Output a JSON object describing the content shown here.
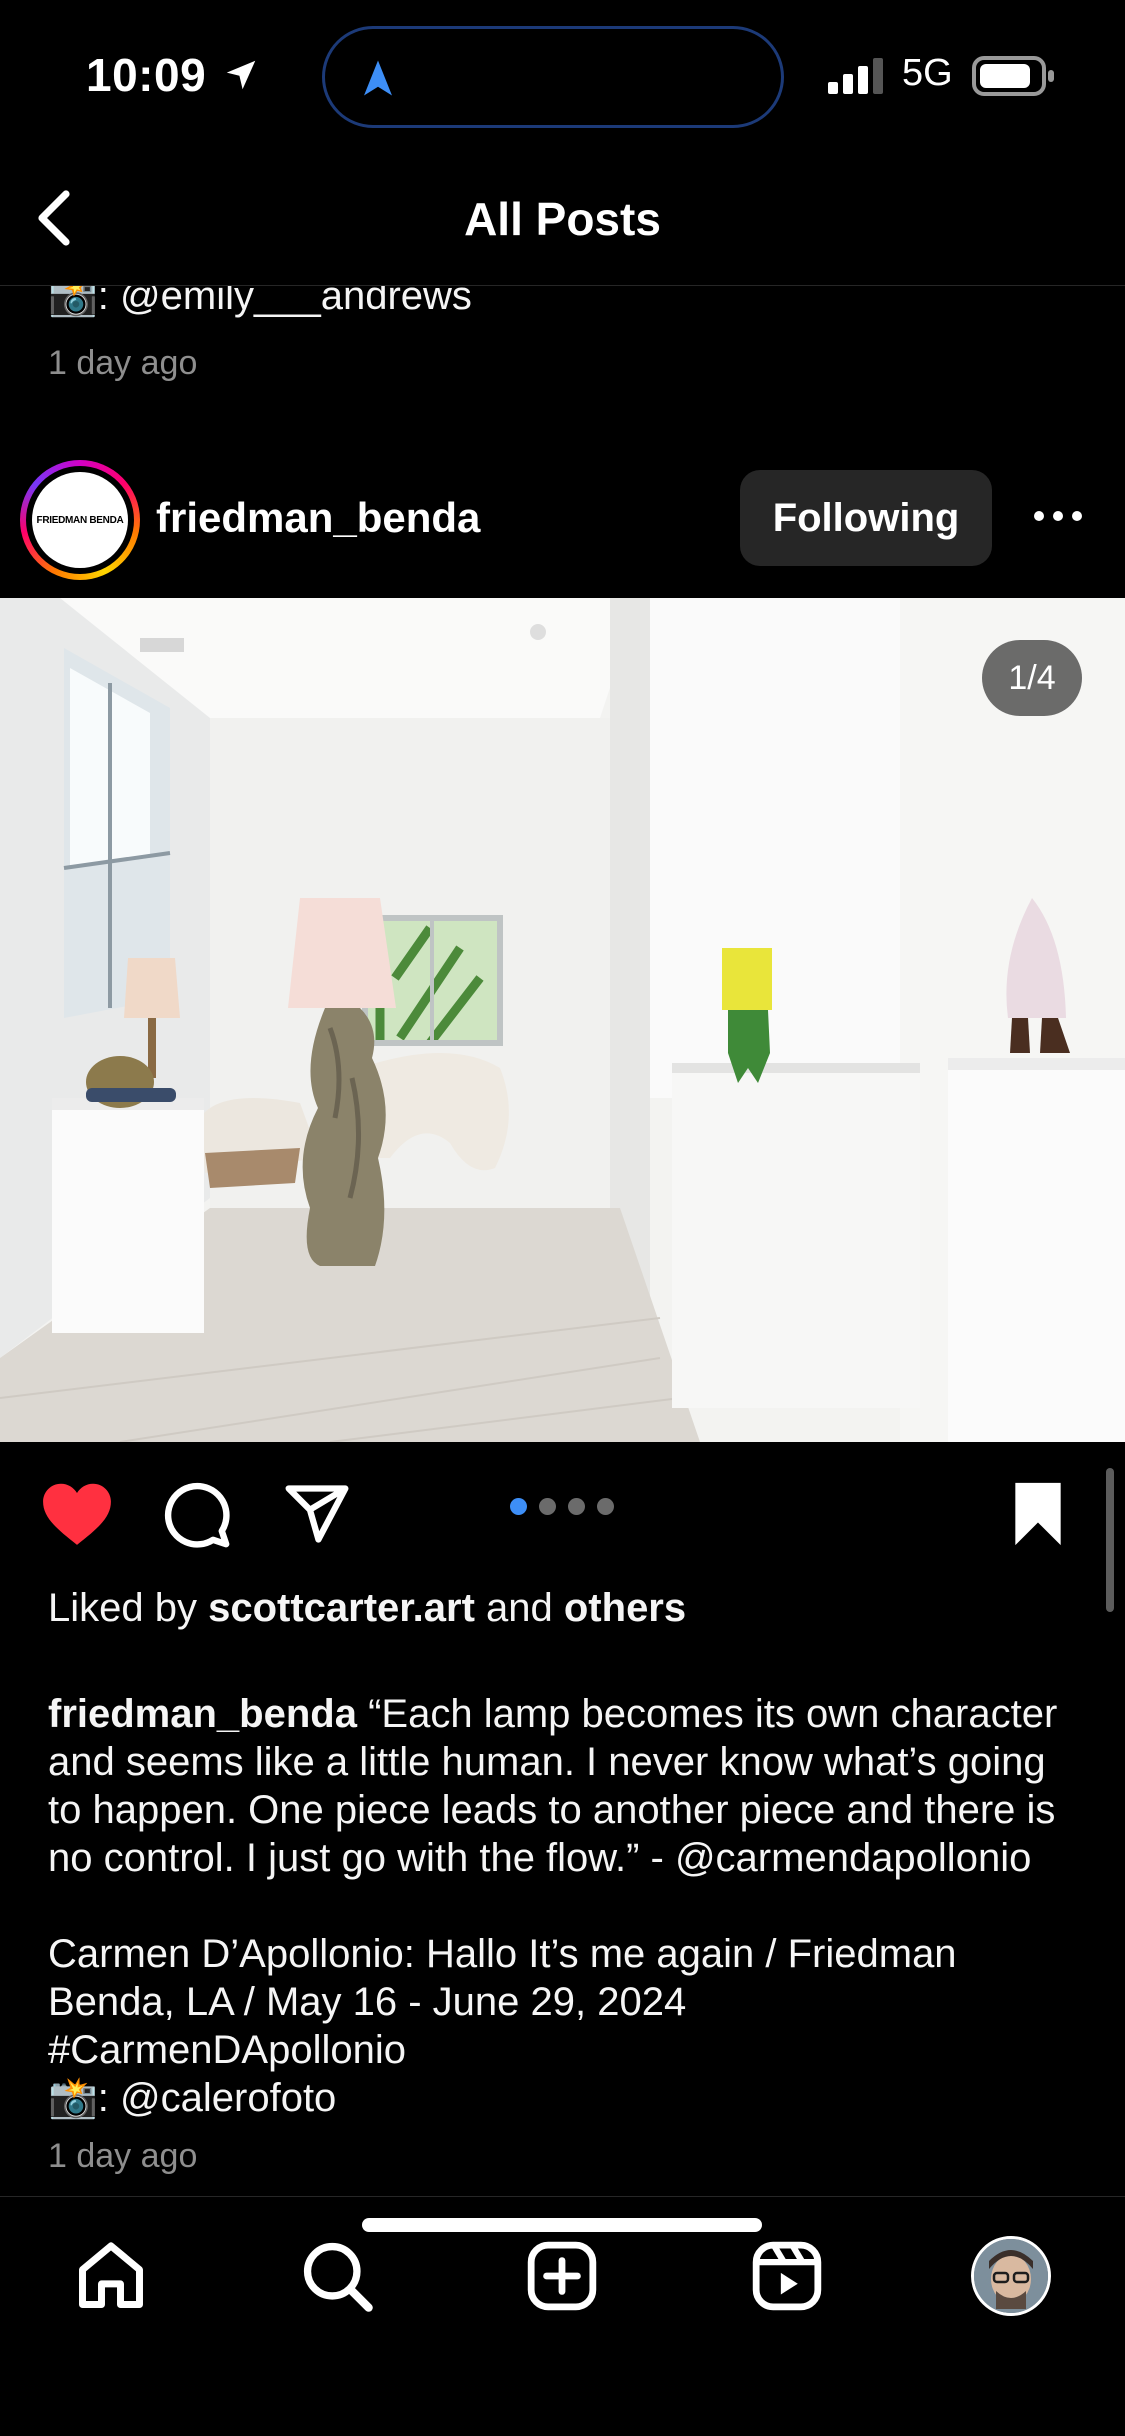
{
  "status_bar": {
    "time": "10:09",
    "network": "5G"
  },
  "header": {
    "title": "All Posts"
  },
  "previous_post": {
    "credit": "📸: @emily___andrews",
    "time_ago": "1 day ago"
  },
  "post": {
    "username": "friedman_benda",
    "avatar_text": "FRIEDMAN BENDA",
    "follow_label": "Following",
    "image_counter": "1/4",
    "carousel": {
      "total": 4,
      "active_index": 0
    },
    "liked": true,
    "saved": true,
    "likes": {
      "prefix": "Liked by ",
      "user": "scottcarter.art",
      "middle": " and ",
      "suffix": "others"
    },
    "caption_user": "friedman_benda",
    "caption_text": " “Each lamp becomes its own character and seems like a little human. I never know what’s going to happen. One piece leads to another piece and there is no control. I just go with the flow.” - @carmendapollonio",
    "caption_line2": "Carmen D’Apollonio: Hallo It’s me again / Friedman Benda, LA / May 16 - June 29, 2024",
    "hashtag": "#CarmenDApollonio",
    "photo_credit": "📸: @calerofoto",
    "time_ago": "1 day ago"
  },
  "colors": {
    "accent_blue": "#3d8ef6",
    "like_red": "#ff3040",
    "button_bg": "#262626"
  }
}
